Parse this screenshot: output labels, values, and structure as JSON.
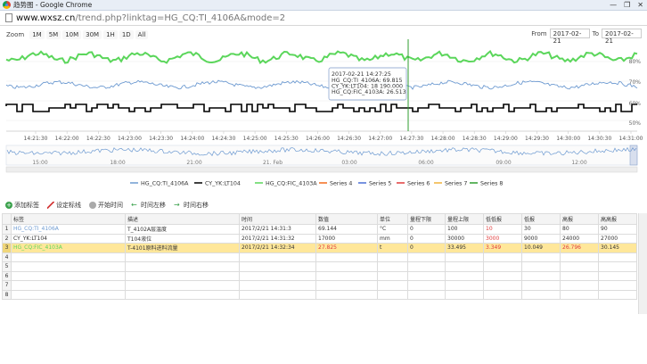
{
  "window": {
    "title": "趋势图 - Google Chrome",
    "minimize": "—",
    "restore": "❐",
    "close": "✕"
  },
  "address": {
    "host": "www.wxsz.cn",
    "path": "/trend.php?linktag=HG_CQ:TI_4106A&mode=2"
  },
  "zoom": {
    "label": "Zoom",
    "buttons": [
      "1M",
      "5M",
      "10M",
      "30M",
      "1H",
      "1D",
      "All"
    ]
  },
  "range": {
    "from_label": "From",
    "from_value": "2017-02-21",
    "to_label": "To",
    "to_value": "2017-02-21"
  },
  "chart_data": {
    "type": "line",
    "y_labels": [
      "80%",
      "70%",
      "60%",
      "50%"
    ],
    "x_ticks": [
      "14:21:30",
      "14:22:00",
      "14:22:30",
      "14:23:00",
      "14:23:30",
      "14:24:00",
      "14:24:30",
      "14:25:00",
      "14:25:30",
      "14:26:00",
      "14:26:30",
      "14:27:00",
      "14:27:30",
      "14:28:00",
      "14:28:30",
      "14:29:00",
      "14:29:30",
      "14:30:00",
      "14:30:30",
      "14:31:00"
    ],
    "navigator_ticks": [
      "15:00",
      "18:00",
      "21:00",
      "21. Feb",
      "03:00",
      "06:00",
      "09:00",
      "12:00"
    ],
    "colors": {
      "TI_4106A": "#6d9ad1",
      "LT104": "#000000",
      "FIC_4103A": "#5bd65b",
      "crosshair": "#2f9e2f"
    },
    "tooltip": {
      "time": "2017-02-21 14:27:25",
      "lines": [
        "HG_CQ:TI_4106A: 69.815",
        "CY_YK:LT104: 18 190.000",
        "HG_CQ:FIC_4103A: 26.513"
      ]
    },
    "series": [
      {
        "name": "HG_CQ:TI_4106A",
        "color": "#6d9ad1"
      },
      {
        "name": "CY_YK:LT104",
        "color": "#000000"
      },
      {
        "name": "HG_CQ:FIC_4103A",
        "color": "#5bd65b"
      },
      {
        "name": "Series 4",
        "color": "#f36b1c"
      },
      {
        "name": "Series 5",
        "color": "#4a6fd6"
      },
      {
        "name": "Series 6",
        "color": "#e03c3c"
      },
      {
        "name": "Series 7",
        "color": "#f0b23c"
      },
      {
        "name": "Series 8",
        "color": "#2f9e2f"
      }
    ]
  },
  "toolbar": {
    "add": "添加标签",
    "set_line": "设定标线",
    "start": "开始时间",
    "left": "时间左移",
    "right": "时间右移"
  },
  "table": {
    "headers": [
      "标签",
      "描述",
      "时间",
      "数值",
      "单位",
      "量程下限",
      "量程上限",
      "低低报",
      "低报",
      "高报",
      "高高报"
    ],
    "rows": [
      {
        "n": "1",
        "cells": [
          "HG_CQ:TI_4106A",
          "T_4102A层温度",
          "2017/2/21 14:31:3",
          "69.144",
          "°C",
          "0",
          "100",
          "10",
          "30",
          "80",
          "90"
        ]
      },
      {
        "n": "2",
        "cells": [
          "CY_YK:LT104",
          "T104液位",
          "2017/2/21 14:31:32",
          "17000",
          "mm",
          "0",
          "30000",
          "3000",
          "9000",
          "24000",
          "27000"
        ]
      },
      {
        "n": "3",
        "cells": [
          "HG_CQ:FIC_4103A",
          "T-4101原料进料流量",
          "2017/2/21 14:32:34",
          "27.825",
          "t",
          "0",
          "33.495",
          "3.349",
          "10.049",
          "26.796",
          "30.145"
        ]
      },
      {
        "n": "4",
        "cells": [
          "",
          "",
          "",
          "",
          "",
          "",
          "",
          "",
          "",
          "",
          ""
        ]
      },
      {
        "n": "5",
        "cells": [
          "",
          "",
          "",
          "",
          "",
          "",
          "",
          "",
          "",
          "",
          ""
        ]
      },
      {
        "n": "6",
        "cells": [
          "",
          "",
          "",
          "",
          "",
          "",
          "",
          "",
          "",
          "",
          ""
        ]
      },
      {
        "n": "7",
        "cells": [
          "",
          "",
          "",
          "",
          "",
          "",
          "",
          "",
          "",
          "",
          ""
        ]
      },
      {
        "n": "8",
        "cells": [
          "",
          "",
          "",
          "",
          "",
          "",
          "",
          "",
          "",
          "",
          ""
        ]
      }
    ]
  }
}
